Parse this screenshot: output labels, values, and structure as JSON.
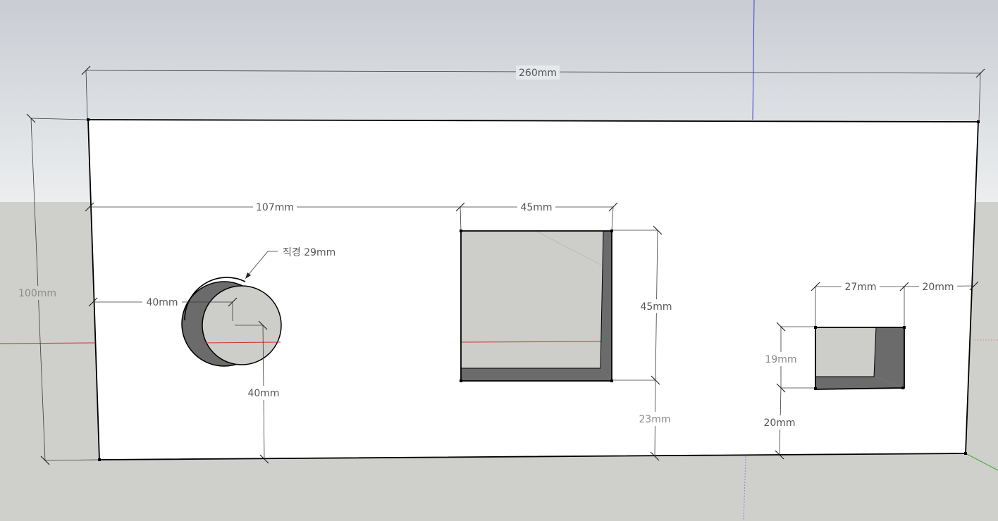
{
  "colors": {
    "sky_top": "#c9cdd3",
    "sky_bottom": "#eceeef",
    "ground": "#cfcfcb",
    "panel_face": "#ffffff",
    "hole_back": "#cdcdca",
    "hole_side": "#6b6b6b",
    "axis_red": "#d03030",
    "axis_blue": "#3a3ad8",
    "axis_green": "#30b030"
  },
  "dimensions": {
    "overall_width": "260mm",
    "overall_height": "100mm",
    "square_offset_x": "107mm",
    "square_width": "45mm",
    "square_height": "45mm",
    "square_offset_bottom": "23mm",
    "circle_offset_x": "40mm",
    "circle_offset_bottom": "40mm",
    "circle_diameter": "직경 29mm",
    "rect_width": "27mm",
    "rect_offset_right": "20mm",
    "rect_height": "19mm",
    "rect_offset_bottom": "20mm"
  }
}
